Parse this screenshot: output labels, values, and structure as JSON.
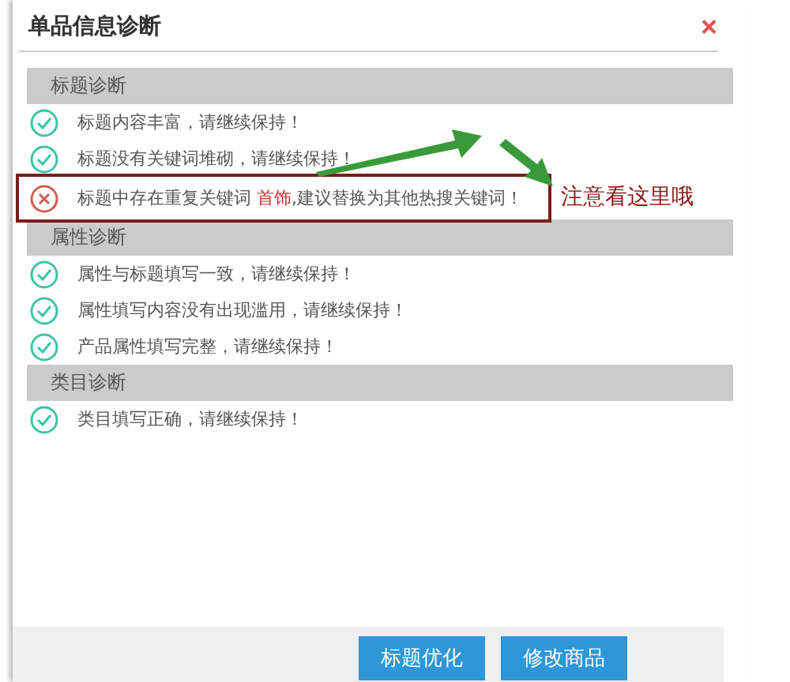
{
  "dialog": {
    "title": "单品信息诊断",
    "close": "×"
  },
  "sections": [
    {
      "title": "标题诊断",
      "items": [
        {
          "kind": "ok",
          "text": "标题内容丰富，请继续保持！"
        },
        {
          "kind": "ok",
          "text": "标题没有关键词堆砌，请继续保持！"
        },
        {
          "kind": "error",
          "text": "标题中存在重复关键词",
          "keyword": "首饰",
          "after": ",建议替换为其他热搜关键词！",
          "highlighted": true
        }
      ]
    },
    {
      "title": "属性诊断",
      "items": [
        {
          "kind": "ok",
          "text": "属性与标题填写一致，请继续保持！"
        },
        {
          "kind": "ok",
          "text": "属性填写内容没有出现滥用，请继续保持！"
        },
        {
          "kind": "ok",
          "text": "产品属性填写完整，请继续保持！"
        }
      ]
    },
    {
      "title": "类目诊断",
      "items": [
        {
          "kind": "ok",
          "text": "类目填写正确，请继续保持！"
        }
      ]
    }
  ],
  "annotation": {
    "text": "注意看这里哦"
  },
  "buttons": [
    "标题优化",
    "修改商品"
  ]
}
